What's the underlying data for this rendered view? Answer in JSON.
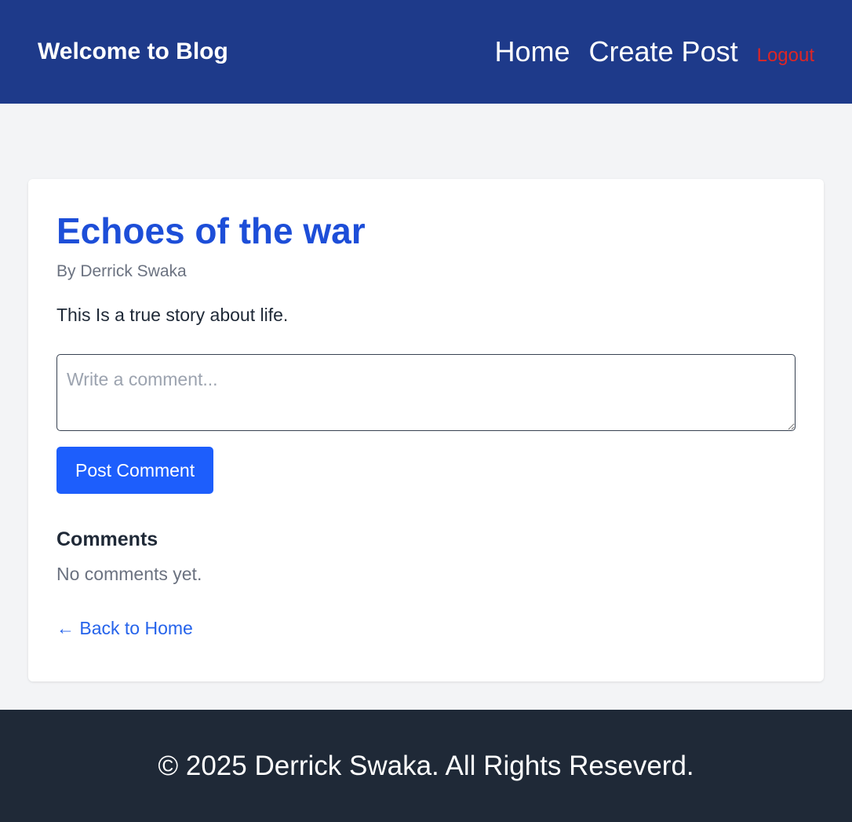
{
  "header": {
    "brand": "Welcome to Blog",
    "nav": {
      "home": "Home",
      "create_post": "Create Post",
      "logout": "Logout"
    }
  },
  "post": {
    "title": "Echoes of the war",
    "author": "By Derrick Swaka",
    "content": "This Is a true story about life."
  },
  "comment_form": {
    "placeholder": "Write a comment...",
    "value": "",
    "submit_label": "Post Comment"
  },
  "comments": {
    "heading": "Comments",
    "empty_text": "No comments yet."
  },
  "back_link": "← Back to Home",
  "footer": {
    "text": "© 2025 Derrick Swaka. All Rights Reseverd."
  },
  "colors": {
    "header_bg": "#1e3a8a",
    "accent": "#1d4ed8",
    "button": "#1d5efc",
    "logout": "#dc2626",
    "footer_bg": "#1f2937",
    "page_bg": "#f3f4f6"
  }
}
